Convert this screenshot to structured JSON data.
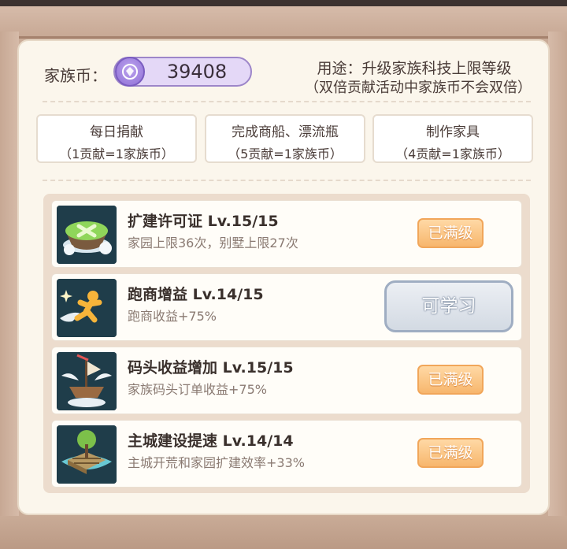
{
  "header": {
    "coin_label": "家族币：",
    "coin_value": "39408",
    "usage_line1": "用途：升级家族科技上限等级",
    "usage_line2": "（双倍贡献活动中家族币不会双倍）"
  },
  "sources": [
    {
      "title": "每日捐献",
      "rate": "（1贡献=1家族币）"
    },
    {
      "title": "完成商船、漂流瓶",
      "rate": "（5贡献=1家族币）"
    },
    {
      "title": "制作家具",
      "rate": "（4贡献=1家族币）"
    }
  ],
  "skills": [
    {
      "name": "扩建许可证 Lv.15/15",
      "desc": "家园上限36次，别墅上限27次",
      "button": "已满级",
      "icon": "expansion-permit-island-icon"
    },
    {
      "name": "跑商增益 Lv.14/15",
      "desc": "跑商收益+75%",
      "button": "可学习",
      "icon": "running-merchant-icon"
    },
    {
      "name": "码头收益增加 Lv.15/15",
      "desc": "家族码头订单收益+75%",
      "button": "已满级",
      "icon": "flying-ship-icon"
    },
    {
      "name": "主城建设提速 Lv.14/14",
      "desc": "主城开荒和家园扩建效率+33%",
      "button": "已满级",
      "icon": "city-construction-icon"
    }
  ],
  "colors": {
    "max_button": "#f7b66d",
    "learn_button": "#d3dae3",
    "coin_pill": "#e4d8f7"
  }
}
